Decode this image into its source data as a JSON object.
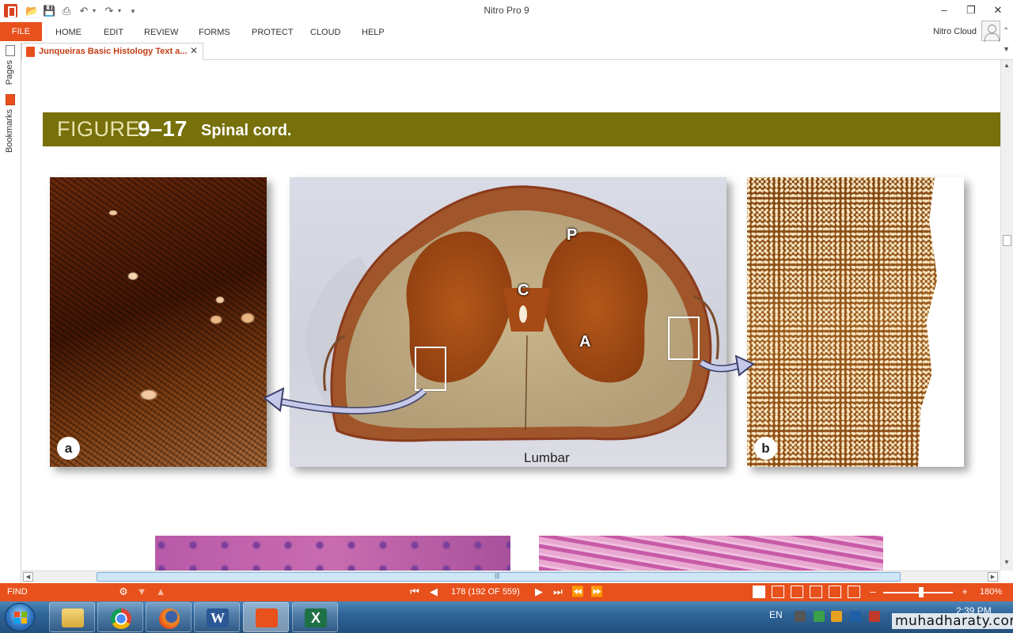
{
  "window": {
    "title": "Nitro Pro 9",
    "minimize": "–",
    "restore": "❐",
    "close": "✕"
  },
  "quick_access": {
    "icons": [
      "open-icon",
      "save-icon",
      "print-icon",
      "undo-icon",
      "redo-icon",
      "customize-icon"
    ]
  },
  "menu": {
    "file": "FILE",
    "items": [
      "HOME",
      "EDIT",
      "REVIEW",
      "FORMS",
      "PROTECT",
      "CLOUD",
      "HELP"
    ],
    "account": "Nitro Cloud"
  },
  "tabs": [
    {
      "label": "Junqueiras Basic Histology Text a...",
      "close": "✕"
    }
  ],
  "left_panel": {
    "pages_label": "Pages",
    "bookmarks_label": "Bookmarks"
  },
  "document": {
    "figure_word": "FIGURE",
    "figure_number": "9–17",
    "figure_title": "Spinal cord.",
    "panel_letters": {
      "a": "a",
      "b": "b"
    },
    "cord_labels": {
      "p": "P",
      "c": "C",
      "a": "A"
    },
    "caption": "Lumbar"
  },
  "status_bar": {
    "find": "FIND",
    "page_indicator": "178 (192 OF 559)",
    "zoom_minus": "–",
    "zoom_plus": "+",
    "zoom_level": "180%",
    "zoom_fraction": 0.55
  },
  "taskbar": {
    "apps": [
      "file-explorer",
      "chrome",
      "firefox",
      "word",
      "nitro-pro",
      "excel"
    ],
    "language": "EN",
    "time": "2:39 PM"
  },
  "watermark": "muhadharaty.com",
  "colors": {
    "accent": "#e8501c",
    "figure_banner": "#77700b",
    "tab_text": "#c43d15"
  }
}
